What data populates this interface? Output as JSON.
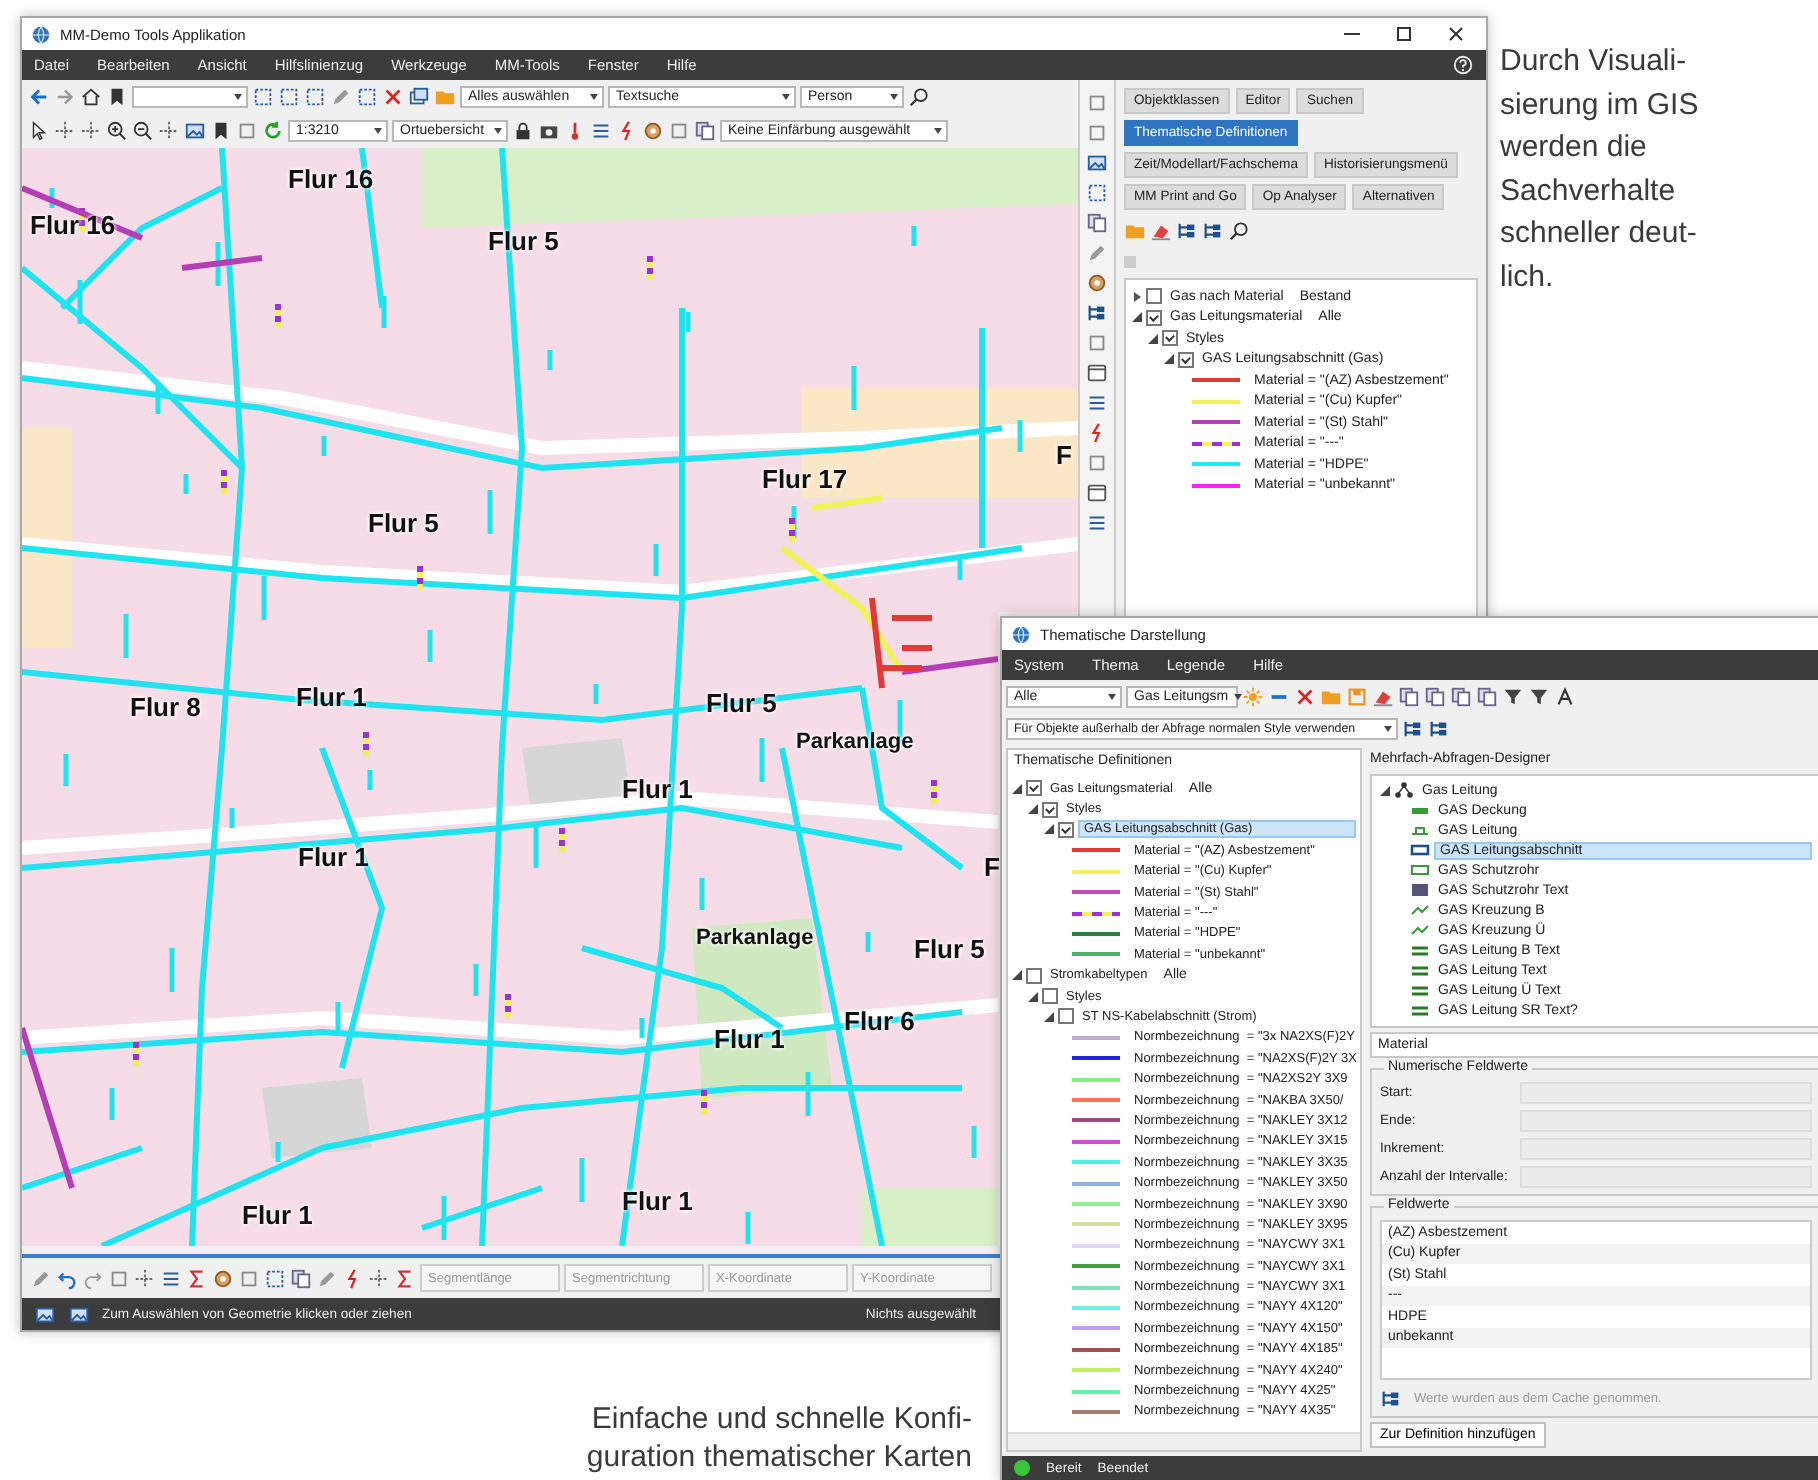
{
  "main_window": {
    "title": "MM-Demo Tools Applikation",
    "menu": [
      "Datei",
      "Bearbeiten",
      "Ansicht",
      "Hilfslinienzug",
      "Werkzeuge",
      "MM-Tools",
      "Fenster",
      "Hilfe"
    ],
    "toolbar": {
      "selection": "Alles auswählen",
      "text_search": "Textsuche",
      "search_type": "Person",
      "scale": "1:3210",
      "overview": "Ortuebersicht",
      "coloring": "Keine Einfärbung ausgewählt"
    },
    "map": {
      "labels": [
        "Flur 16",
        "Flur 16",
        "Flur 5",
        "Flur 17",
        "F",
        "Flur 5",
        "Flur 8",
        "Flur 1",
        "Flur 5",
        "Parkanlage",
        "Flur 1",
        "Flur 1",
        "Parkanlage",
        "Flur 5",
        "Flur 1",
        "Flur 6",
        "Flur 1",
        "Flur 1",
        "F"
      ]
    },
    "panel": {
      "buttons": [
        {
          "label": "Objektklassen",
          "selected": false
        },
        {
          "label": "Editor",
          "selected": false
        },
        {
          "label": "Suchen",
          "selected": false
        },
        {
          "label": "Thematische Definitionen",
          "selected": true
        },
        {
          "label": "Zeit/Modellart/Fachschema",
          "selected": false
        },
        {
          "label": "Historisierungsmenü",
          "selected": false
        },
        {
          "label": "MM Print and Go",
          "selected": false
        },
        {
          "label": "Op Analyser",
          "selected": false
        },
        {
          "label": "Alternativen",
          "selected": false
        }
      ],
      "tree": [
        {
          "label": "Gas nach Material",
          "filter": "Bestand",
          "checked": false,
          "expanded": false
        },
        {
          "label": "Gas Leitungsmaterial",
          "filter": "Alle",
          "checked": true,
          "expanded": true,
          "children": [
            {
              "label": "Styles",
              "checked": true,
              "expanded": true,
              "children": [
                {
                  "label": "GAS Leitungsabschnitt (Gas)",
                  "checked": true,
                  "expanded": true,
                  "children": [
                    {
                      "kind": "legend_line",
                      "color": "#e53935",
                      "label": "Material = \"(AZ) Asbestzement\""
                    },
                    {
                      "kind": "legend_line",
                      "color": "#f2f25a",
                      "label": "Material = \"(Cu) Kupfer\""
                    },
                    {
                      "kind": "legend_line",
                      "color": "#b43fb4",
                      "label": "Material = \"(St) Stahl\""
                    },
                    {
                      "kind": "legend_dashed",
                      "color": "#9b30e0",
                      "label": "Material = \"---\""
                    },
                    {
                      "kind": "legend_line",
                      "color": "#22e6f2",
                      "label": "Material = \"HDPE\""
                    },
                    {
                      "kind": "legend_line",
                      "color": "#ff22ff",
                      "label": "Material = \"unbekannt\""
                    }
                  ]
                }
              ]
            }
          ]
        }
      ]
    },
    "edit_toolbar": {
      "fields": [
        {
          "placeholder": "Segmentlänge"
        },
        {
          "placeholder": "Segmentrichtung"
        },
        {
          "placeholder": "X-Koordinate"
        },
        {
          "placeholder": "Y-Koordinate"
        }
      ]
    },
    "status_bar": {
      "hint": "Zum Auswählen von Geometrie klicken oder ziehen",
      "selection": "Nichts ausgewählt"
    }
  },
  "thematic_window": {
    "title": "Thematische Darstellung",
    "menu": [
      "System",
      "Thema",
      "Legende",
      "Hilfe"
    ],
    "filter": "Alle",
    "layer": "Gas Leitungsm",
    "style_option": "Für Objekte außerhalb der Abfrage normalen Style verwenden",
    "definitions": {
      "title": "Thematische Definitionen",
      "tree": [
        {
          "label": "Gas Leitungsmaterial",
          "filter": "Alle",
          "checked": true,
          "expanded": true,
          "selected": false,
          "children": [
            {
              "label": "Styles",
              "checked": true,
              "expanded": true,
              "selected": false,
              "children": [
                {
                  "label": "GAS Leitungsabschnitt (Gas)",
                  "checked": true,
                  "expanded": true,
                  "selected": true,
                  "children": [
                    {
                      "kind": "legend_line",
                      "color": "#e53935",
                      "label": "Material = \"(AZ) Asbestzement\""
                    },
                    {
                      "kind": "legend_line",
                      "color": "#f2f25a",
                      "label": "Material = \"(Cu) Kupfer\""
                    },
                    {
                      "kind": "legend_line",
                      "color": "#c04cc0",
                      "label": "Material = \"(St) Stahl\""
                    },
                    {
                      "kind": "legend_dashed",
                      "color": "#9b30e0",
                      "label": "Material = \"---\""
                    },
                    {
                      "kind": "legend_line",
                      "color": "#2e7d3c",
                      "label": "Material = \"HDPE\""
                    },
                    {
                      "kind": "legend_line",
                      "color": "#4caf6a",
                      "label": "Material = \"unbekannt\""
                    }
                  ]
                }
              ]
            }
          ]
        },
        {
          "label": "Stromkabeltypen",
          "filter": "Alle",
          "checked": false,
          "expanded": true,
          "selected": false,
          "children": [
            {
              "label": "Styles",
              "checked": false,
              "expanded": true,
              "selected": false,
              "children": [
                {
                  "label": "ST NS-Kabelabschnitt (Strom)",
                  "checked": false,
                  "expanded": true,
                  "selected": false,
                  "children": [
                    {
                      "kind": "legend_line",
                      "color": "#c0a8d8",
                      "label": "Normbezeichnung  = \"3x NA2XS(F)2Y"
                    },
                    {
                      "kind": "legend_line",
                      "color": "#2424e0",
                      "label": "Normbezeichnung  = \"NA2XS(F)2Y 3X"
                    },
                    {
                      "kind": "legend_line",
                      "color": "#84f084",
                      "label": "Normbezeichnung  = \"NA2XS2Y 3X9"
                    },
                    {
                      "kind": "legend_line",
                      "color": "#ff7050",
                      "label": "Normbezeichnung  = \"NAKBA 3X50/"
                    },
                    {
                      "kind": "legend_line",
                      "color": "#a04880",
                      "label": "Normbezeichnung  = \"NAKLEY 3X12"
                    },
                    {
                      "kind": "legend_line",
                      "color": "#d050d0",
                      "label": "Normbezeichnung  = \"NAKLEY 3X15"
                    },
                    {
                      "kind": "legend_line",
                      "color": "#50f0e0",
                      "label": "Normbezeichnung  = \"NAKLEY 3X35"
                    },
                    {
                      "kind": "legend_line",
                      "color": "#90b0e0",
                      "label": "Normbezeichnung  = \"NAKLEY 3X50"
                    },
                    {
                      "kind": "legend_line",
                      "color": "#90f090",
                      "label": "Normbezeichnung  = \"NAKLEY 3X90"
                    },
                    {
                      "kind": "legend_line",
                      "color": "#d8e0a0",
                      "label": "Normbezeichnung  = \"NAKLEY 3X95"
                    },
                    {
                      "kind": "legend_line",
                      "color": "#e0d8f0",
                      "label": "Normbezeichnung  = \"NAYCWY 3X1"
                    },
                    {
                      "kind": "legend_line",
                      "color": "#40a040",
                      "label": "Normbezeichnung  = \"NAYCWY 3X1"
                    },
                    {
                      "kind": "legend_line",
                      "color": "#80e0b0",
                      "label": "Normbezeichnung  = \"NAYCWY 3X1"
                    },
                    {
                      "kind": "legend_line",
                      "color": "#70f0e0",
                      "label": "Normbezeichnung  = \"NAYY 4X120\""
                    },
                    {
                      "kind": "legend_line",
                      "color": "#c0a0f0",
                      "label": "Normbezeichnung  = \"NAYY 4X150\""
                    },
                    {
                      "kind": "legend_line",
                      "color": "#a05050",
                      "label": "Normbezeichnung  = \"NAYY 4X185\""
                    },
                    {
                      "kind": "legend_line",
                      "color": "#c0f060",
                      "label": "Normbezeichnung  = \"NAYY 4X240\""
                    },
                    {
                      "kind": "legend_line",
                      "color": "#60f0b0",
                      "label": "Normbezeichnung  = \"NAYY 4X25\""
                    },
                    {
                      "kind": "legend_line",
                      "color": "#a08070",
                      "label": "Normbezeichnung  = \"NAYY 4X35\""
                    }
                  ]
                }
              ]
            }
          ]
        }
      ]
    },
    "designer": {
      "title": "Mehrfach-Abfragen-Designer",
      "tree": [
        {
          "label": "Gas Leitung",
          "expanded": true,
          "selected": false,
          "children": [
            {
              "label": "GAS Deckung",
              "selected": false
            },
            {
              "label": "GAS Leitung",
              "selected": false
            },
            {
              "label": "GAS Leitungsabschnitt",
              "selected": true
            },
            {
              "label": "GAS Schutzrohr",
              "selected": false
            },
            {
              "label": "GAS Schutzrohr Text",
              "selected": false
            },
            {
              "label": "GAS Kreuzung B",
              "selected": false
            },
            {
              "label": "GAS Kreuzung Ü",
              "selected": false
            },
            {
              "label": "GAS Leitung B Text",
              "selected": false
            },
            {
              "label": "GAS Leitung Text",
              "selected": false
            },
            {
              "label": "GAS Leitung Ü Text",
              "selected": false
            },
            {
              "label": "GAS Leitung SR Text?",
              "selected": false
            }
          ]
        }
      ],
      "field": "Material",
      "numeric": {
        "title": "Numerische Feldwerte",
        "fields": [
          "Start:",
          "Ende:",
          "Inkrement:",
          "Anzahl der Intervalle:"
        ]
      },
      "values": {
        "title": "Feldwerte",
        "items": [
          "(AZ) Asbestzement",
          "(Cu) Kupfer",
          "(St) Stahl",
          "---",
          "HDPE",
          "unbekannt"
        ],
        "message": "Werte wurden aus dem Cache genommen."
      },
      "add_button": "Zur Definition hinzufügen"
    },
    "status": [
      "Bereit",
      "Beendet"
    ]
  },
  "side_text": {
    "lines": [
      "Durch Visuali-",
      "sierung im GIS",
      "werden die",
      "Sachverhalte",
      "schneller deut-",
      "lich."
    ]
  },
  "caption": {
    "lines": [
      "Einfache und schnelle Konfi-",
      "guration thematischer Karten"
    ]
  }
}
